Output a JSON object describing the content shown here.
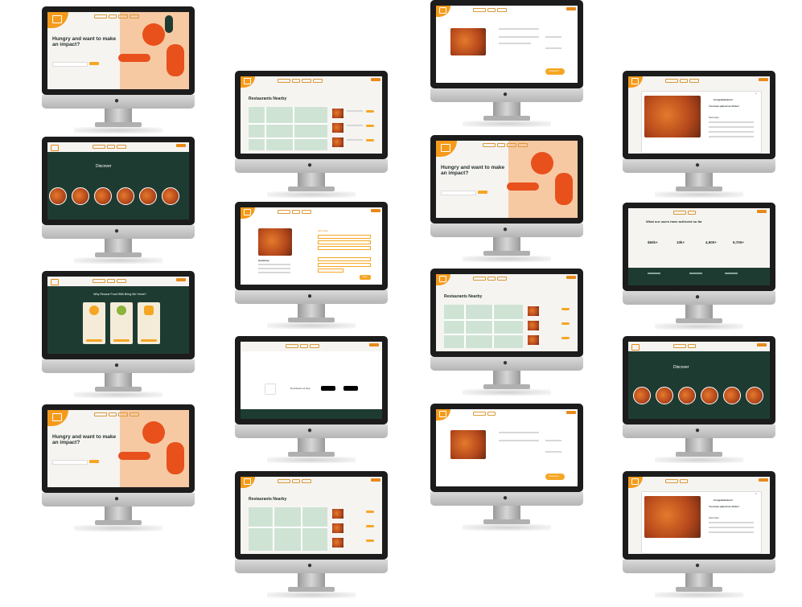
{
  "screens": {
    "hero_title": "Hungry and want to make an impact?",
    "discover": "Discover",
    "why_title": "Why Rescue Food With Bring Me Home?",
    "nearby": "Restaurants Nearby",
    "app_text": "Download our App",
    "achieved": "What our users have achieved so far",
    "stats": [
      "$60k+",
      "10k+",
      "4,900+",
      "9,700+"
    ],
    "congrats": "Congratulations!",
    "placed": "You have placed an Order!",
    "summary": "Summary",
    "checkout": "Checkout",
    "pay": "Pay",
    "details_name": "John Doe"
  },
  "colors": {
    "accent": "#f5a623",
    "dark": "#1e3b32",
    "orange": "#e8501c"
  }
}
